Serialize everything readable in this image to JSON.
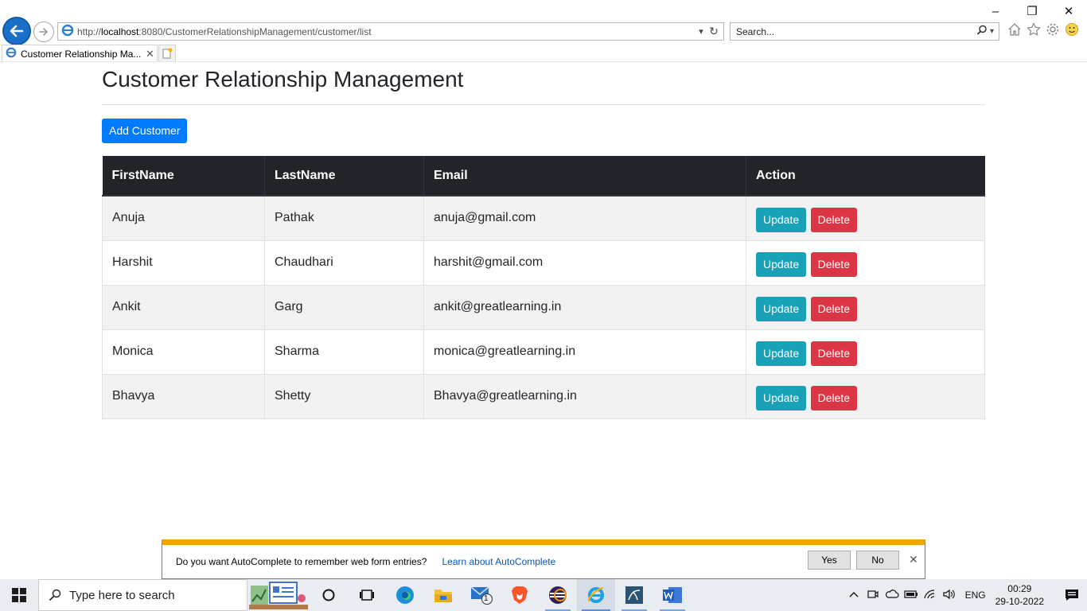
{
  "browser": {
    "url_prefix": "http://",
    "url_host": "localhost",
    "url_rest": ":8080/CustomerRelationshipManagement/customer/list",
    "search_placeholder": "Search...",
    "tab_title": "Customer Relationship Ma...",
    "window_controls": [
      "–",
      "❐",
      "✕"
    ]
  },
  "page": {
    "title": "Customer Relationship Management",
    "add_button": "Add Customer",
    "columns": [
      "FirstName",
      "LastName",
      "Email",
      "Action"
    ],
    "update_label": "Update",
    "delete_label": "Delete",
    "rows": [
      {
        "first": "Anuja",
        "last": "Pathak",
        "email": "anuja@gmail.com"
      },
      {
        "first": "Harshit",
        "last": "Chaudhari",
        "email": "harshit@gmail.com"
      },
      {
        "first": "Ankit",
        "last": "Garg",
        "email": "ankit@greatlearning.in"
      },
      {
        "first": "Monica",
        "last": "Sharma",
        "email": "monica@greatlearning.in"
      },
      {
        "first": "Bhavya",
        "last": "Shetty",
        "email": "Bhavya@greatlearning.in"
      }
    ]
  },
  "autocomplete": {
    "message": "Do you want AutoComplete to remember web form entries?",
    "link": "Learn about AutoComplete",
    "yes": "Yes",
    "no": "No"
  },
  "taskbar": {
    "search_text": "Type here to search",
    "mail_badge": "1",
    "language": "ENG",
    "time": "00:29",
    "date": "29-10-2022"
  },
  "colors": {
    "primary": "#007bff",
    "update": "#17a2b8",
    "delete": "#dc3545",
    "table_header": "#212529",
    "autocomplete_accent": "#f4a400"
  }
}
